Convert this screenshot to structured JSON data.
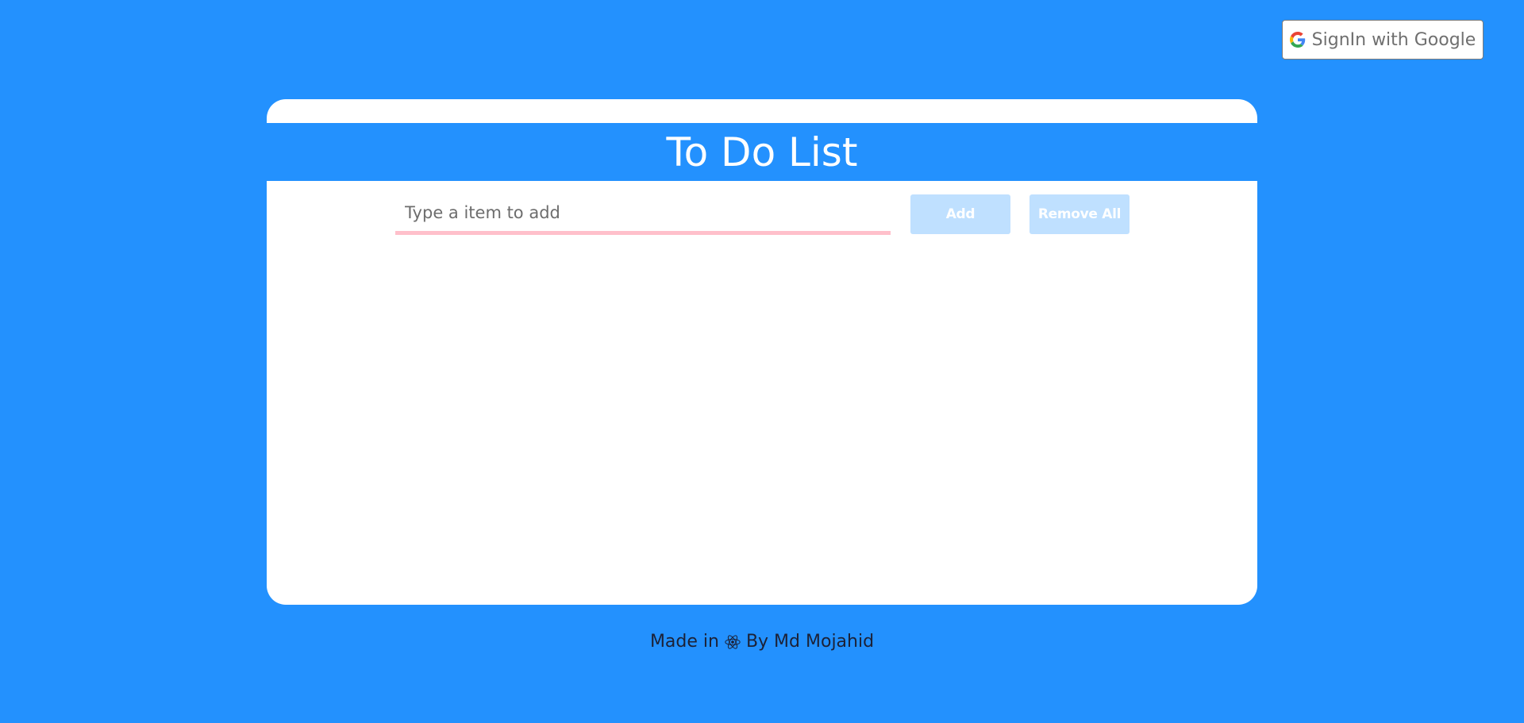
{
  "auth": {
    "signin_label": "SignIn with Google",
    "icon": "google-icon"
  },
  "todo": {
    "title": "To Do List",
    "input_placeholder": "Type a item to add",
    "input_value": "",
    "add_label": "Add",
    "remove_all_label": "Remove All",
    "items": []
  },
  "footer": {
    "made_in": "Made in",
    "icon": "react-icon",
    "by": "By Md Mojahid"
  },
  "colors": {
    "background": "#2391fe",
    "card": "#ffffff",
    "input_underline": "#ffc0cb",
    "button_disabled": "#bfe0ff"
  }
}
